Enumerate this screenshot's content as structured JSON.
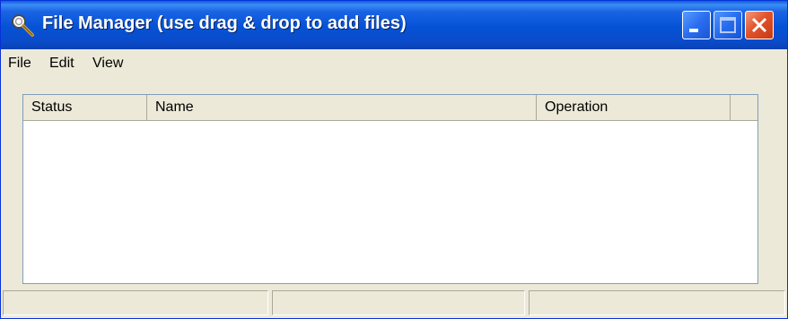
{
  "window": {
    "title": "File Manager (use drag & drop to add files)",
    "icon": "magnifier-icon"
  },
  "title_buttons": [
    "minimize-icon",
    "maximize-icon",
    "close-icon"
  ],
  "menu": {
    "items": [
      {
        "label": "File"
      },
      {
        "label": "Edit"
      },
      {
        "label": "View"
      }
    ]
  },
  "file_list": {
    "columns": [
      {
        "label": "Status"
      },
      {
        "label": "Name"
      },
      {
        "label": "Operation"
      }
    ],
    "rows": []
  },
  "status_bar": {
    "panels": [
      "",
      "",
      ""
    ]
  },
  "colors": {
    "titlebar": "#0552d6",
    "face": "#ece9d8",
    "close_button": "#e2532b",
    "list_background": "#ffffff"
  }
}
